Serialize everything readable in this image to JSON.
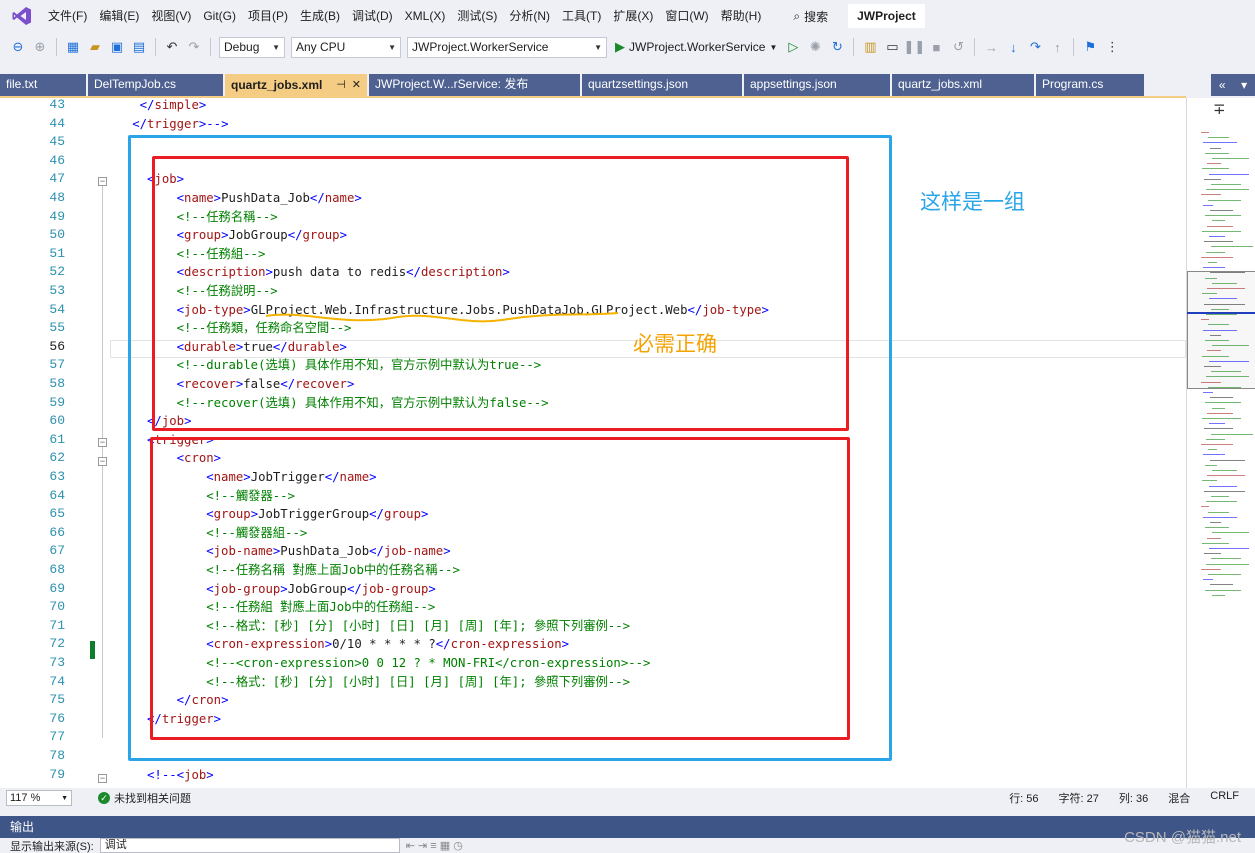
{
  "menubar": {
    "items": [
      "文件(F)",
      "编辑(E)",
      "视图(V)",
      "Git(G)",
      "项目(P)",
      "生成(B)",
      "调试(D)",
      "XML(X)",
      "测试(S)",
      "分析(N)",
      "工具(T)",
      "扩展(X)",
      "窗口(W)",
      "帮助(H)"
    ],
    "search_label": "搜索",
    "project_title": "JWProject"
  },
  "toolbar": {
    "config": "Debug",
    "platform": "Any CPU",
    "startup_project": "JWProject.WorkerService",
    "run_target": "JWProject.WorkerService"
  },
  "tabs": [
    "file.txt",
    "DelTempJob.cs",
    "quartz_jobs.xml",
    "JWProject.W...rService: 发布",
    "quartzsettings.json",
    "appsettings.json",
    "quartz_jobs.xml",
    "Program.cs"
  ],
  "active_tab": 2,
  "tab_controls": {
    "pin": "⊣",
    "close": "✕"
  },
  "editor": {
    "lines": [
      {
        "n": "43",
        "t": [
          [
            "    ",
            "txt"
          ],
          [
            "</",
            "br"
          ],
          [
            "simple",
            "tag"
          ],
          [
            ">",
            "br"
          ]
        ]
      },
      {
        "n": "44",
        "t": [
          [
            "   ",
            "txt"
          ],
          [
            "</",
            "br"
          ],
          [
            "trigger",
            "tag"
          ],
          [
            ">--",
            "br"
          ],
          [
            ">",
            "br"
          ]
        ]
      },
      {
        "n": "45",
        "t": []
      },
      {
        "n": "46",
        "t": []
      },
      {
        "n": "47",
        "t": [
          [
            "     ",
            "txt"
          ],
          [
            "<",
            "br"
          ],
          [
            "job",
            "tag"
          ],
          [
            ">",
            "br"
          ]
        ]
      },
      {
        "n": "48",
        "t": [
          [
            "         ",
            "txt"
          ],
          [
            "<",
            "br"
          ],
          [
            "name",
            "tag"
          ],
          [
            ">",
            "br"
          ],
          [
            "PushData_Job",
            "txt"
          ],
          [
            "</",
            "br"
          ],
          [
            "name",
            "tag"
          ],
          [
            ">",
            "br"
          ]
        ]
      },
      {
        "n": "49",
        "t": [
          [
            "         ",
            "txt"
          ],
          [
            "<!--任務名稱-->",
            "cmt"
          ]
        ]
      },
      {
        "n": "50",
        "t": [
          [
            "         ",
            "txt"
          ],
          [
            "<",
            "br"
          ],
          [
            "group",
            "tag"
          ],
          [
            ">",
            "br"
          ],
          [
            "JobGroup",
            "txt"
          ],
          [
            "</",
            "br"
          ],
          [
            "group",
            "tag"
          ],
          [
            ">",
            "br"
          ]
        ]
      },
      {
        "n": "51",
        "t": [
          [
            "         ",
            "txt"
          ],
          [
            "<!--任務組-->",
            "cmt"
          ]
        ]
      },
      {
        "n": "52",
        "t": [
          [
            "         ",
            "txt"
          ],
          [
            "<",
            "br"
          ],
          [
            "description",
            "tag"
          ],
          [
            ">",
            "br"
          ],
          [
            "push data to redis",
            "txt"
          ],
          [
            "</",
            "br"
          ],
          [
            "description",
            "tag"
          ],
          [
            ">",
            "br"
          ]
        ]
      },
      {
        "n": "53",
        "t": [
          [
            "         ",
            "txt"
          ],
          [
            "<!--任務說明-->",
            "cmt"
          ]
        ]
      },
      {
        "n": "54",
        "t": [
          [
            "         ",
            "txt"
          ],
          [
            "<",
            "br"
          ],
          [
            "job-type",
            "tag"
          ],
          [
            ">",
            "br"
          ],
          [
            "GLProject.Web.Infrastructure.Jobs.PushDataJob,GLProject.Web",
            "txt"
          ],
          [
            "</",
            "br"
          ],
          [
            "job-type",
            "tag"
          ],
          [
            ">",
            "br"
          ]
        ]
      },
      {
        "n": "55",
        "t": [
          [
            "         ",
            "txt"
          ],
          [
            "<!--任務類，任務命名空間-->",
            "cmt"
          ]
        ]
      },
      {
        "n": "56",
        "t": [
          [
            "         ",
            "txt"
          ],
          [
            "<",
            "br"
          ],
          [
            "durable",
            "tag"
          ],
          [
            ">",
            "br"
          ],
          [
            "true",
            "txt"
          ],
          [
            "</",
            "br"
          ],
          [
            "durable",
            "tag"
          ],
          [
            ">",
            "br"
          ]
        ]
      },
      {
        "n": "57",
        "t": [
          [
            "         ",
            "txt"
          ],
          [
            "<!--durable(选填) 具体作用不知，官方示例中默认为true-->",
            "cmt"
          ]
        ]
      },
      {
        "n": "58",
        "t": [
          [
            "         ",
            "txt"
          ],
          [
            "<",
            "br"
          ],
          [
            "recover",
            "tag"
          ],
          [
            ">",
            "br"
          ],
          [
            "false",
            "txt"
          ],
          [
            "</",
            "br"
          ],
          [
            "recover",
            "tag"
          ],
          [
            ">",
            "br"
          ]
        ]
      },
      {
        "n": "59",
        "t": [
          [
            "         ",
            "txt"
          ],
          [
            "<!--recover(选填) 具体作用不知，官方示例中默认为false-->",
            "cmt"
          ]
        ]
      },
      {
        "n": "60",
        "t": [
          [
            "     ",
            "txt"
          ],
          [
            "</",
            "br"
          ],
          [
            "job",
            "tag"
          ],
          [
            ">",
            "br"
          ]
        ]
      },
      {
        "n": "61",
        "t": [
          [
            "     ",
            "txt"
          ],
          [
            "<",
            "br"
          ],
          [
            "trigger",
            "tag"
          ],
          [
            ">",
            "br"
          ]
        ]
      },
      {
        "n": "62",
        "t": [
          [
            "         ",
            "txt"
          ],
          [
            "<",
            "br"
          ],
          [
            "cron",
            "tag"
          ],
          [
            ">",
            "br"
          ]
        ]
      },
      {
        "n": "63",
        "t": [
          [
            "             ",
            "txt"
          ],
          [
            "<",
            "br"
          ],
          [
            "name",
            "tag"
          ],
          [
            ">",
            "br"
          ],
          [
            "JobTrigger",
            "txt"
          ],
          [
            "</",
            "br"
          ],
          [
            "name",
            "tag"
          ],
          [
            ">",
            "br"
          ]
        ]
      },
      {
        "n": "64",
        "t": [
          [
            "             ",
            "txt"
          ],
          [
            "<!--觸發器-->",
            "cmt"
          ]
        ]
      },
      {
        "n": "65",
        "t": [
          [
            "             ",
            "txt"
          ],
          [
            "<",
            "br"
          ],
          [
            "group",
            "tag"
          ],
          [
            ">",
            "br"
          ],
          [
            "JobTriggerGroup",
            "txt"
          ],
          [
            "</",
            "br"
          ],
          [
            "group",
            "tag"
          ],
          [
            ">",
            "br"
          ]
        ]
      },
      {
        "n": "66",
        "t": [
          [
            "             ",
            "txt"
          ],
          [
            "<!--觸發器組-->",
            "cmt"
          ]
        ]
      },
      {
        "n": "67",
        "t": [
          [
            "             ",
            "txt"
          ],
          [
            "<",
            "br"
          ],
          [
            "job-name",
            "tag"
          ],
          [
            ">",
            "br"
          ],
          [
            "PushData_Job",
            "txt"
          ],
          [
            "</",
            "br"
          ],
          [
            "job-name",
            "tag"
          ],
          [
            ">",
            "br"
          ]
        ]
      },
      {
        "n": "68",
        "t": [
          [
            "             ",
            "txt"
          ],
          [
            "<!--任務名稱 對應上面Job中的任務名稱-->",
            "cmt"
          ]
        ]
      },
      {
        "n": "69",
        "t": [
          [
            "             ",
            "txt"
          ],
          [
            "<",
            "br"
          ],
          [
            "job-group",
            "tag"
          ],
          [
            ">",
            "br"
          ],
          [
            "JobGroup",
            "txt"
          ],
          [
            "</",
            "br"
          ],
          [
            "job-group",
            "tag"
          ],
          [
            ">",
            "br"
          ]
        ]
      },
      {
        "n": "70",
        "t": [
          [
            "             ",
            "txt"
          ],
          [
            "<!--任務組 對應上面Job中的任務組-->",
            "cmt"
          ]
        ]
      },
      {
        "n": "71",
        "t": [
          [
            "             ",
            "txt"
          ],
          [
            "<!--格式：[秒] [分] [小时] [日] [月] [周] [年]; 參照下列審例-->",
            "cmt"
          ]
        ]
      },
      {
        "n": "72",
        "t": [
          [
            "             ",
            "txt"
          ],
          [
            "<",
            "br"
          ],
          [
            "cron-expression",
            "tag"
          ],
          [
            ">",
            "br"
          ],
          [
            "0/10 * * * * ?",
            "txt"
          ],
          [
            "</",
            "br"
          ],
          [
            "cron-expression",
            "tag"
          ],
          [
            ">",
            "br"
          ]
        ]
      },
      {
        "n": "73",
        "t": [
          [
            "             ",
            "txt"
          ],
          [
            "<!--<cron-expression>0 0 12 ? * MON-FRI</cron-expression>-->",
            "cmt"
          ]
        ]
      },
      {
        "n": "74",
        "t": [
          [
            "             ",
            "txt"
          ],
          [
            "<!--格式：[秒] [分] [小时] [日] [月] [周] [年]; 參照下列審例-->",
            "cmt"
          ]
        ]
      },
      {
        "n": "75",
        "t": [
          [
            "         ",
            "txt"
          ],
          [
            "</",
            "br"
          ],
          [
            "cron",
            "tag"
          ],
          [
            ">",
            "br"
          ]
        ]
      },
      {
        "n": "76",
        "t": [
          [
            "     ",
            "txt"
          ],
          [
            "</",
            "br"
          ],
          [
            "trigger",
            "tag"
          ],
          [
            ">",
            "br"
          ]
        ]
      },
      {
        "n": "77",
        "t": []
      },
      {
        "n": "78",
        "t": []
      },
      {
        "n": "79",
        "t": [
          [
            "     ",
            "txt"
          ],
          [
            "<!--<",
            "br"
          ],
          [
            "job",
            "tag"
          ],
          [
            ">",
            "br"
          ]
        ]
      }
    ],
    "current_line": "56"
  },
  "annotations": {
    "group_note": "这样是一组",
    "required_note": "必需正确",
    "group_color": "#29a5e8",
    "required_color": "#f5a300"
  },
  "statusbar": {
    "zoom": "117 %",
    "issues": "未找到相关问题",
    "line": "行: 56",
    "char": "字符: 27",
    "col": "列: 36",
    "mode": "混合",
    "eol": "CRLF"
  },
  "output": {
    "title": "输出",
    "source_label": "显示输出来源(S):",
    "source_value": "调试"
  },
  "watermark": "CSDN @猫猫.net"
}
